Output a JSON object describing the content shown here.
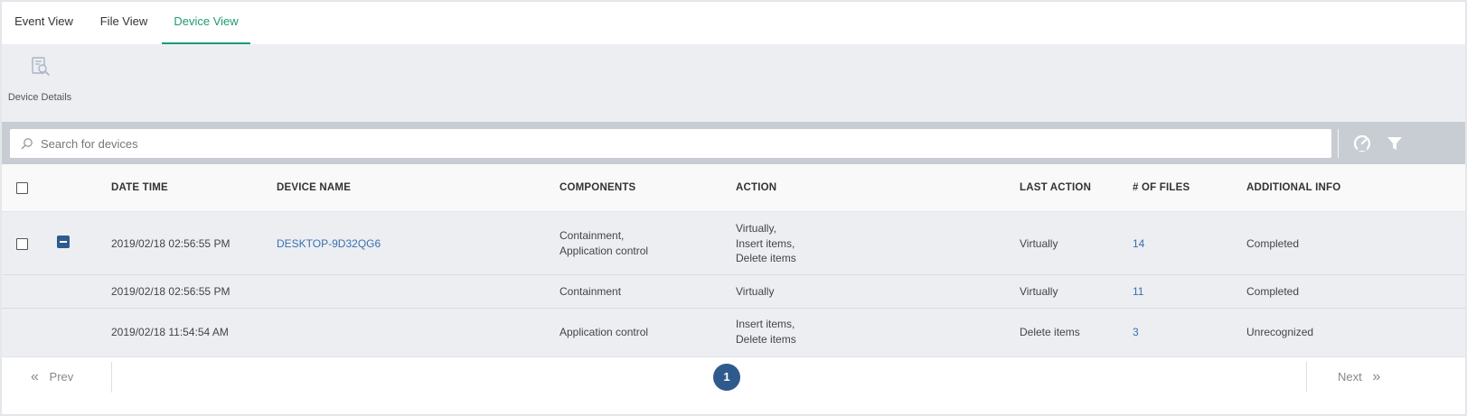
{
  "tabs": [
    {
      "label": "Event View",
      "active": false
    },
    {
      "label": "File View",
      "active": false
    },
    {
      "label": "Device View",
      "active": true
    }
  ],
  "toolbar": {
    "device_details_label": "Device Details",
    "device_details_icon": "device-details-icon"
  },
  "search": {
    "placeholder": "Search for devices",
    "value": ""
  },
  "header_icons": [
    "gauge-icon",
    "filter-icon"
  ],
  "table": {
    "columns": [
      "DATE TIME",
      "DEVICE NAME",
      "COMPONENTS",
      "ACTION",
      "LAST ACTION",
      "# OF FILES",
      "ADDITIONAL INFO"
    ],
    "rows": [
      {
        "date_time": "2019/02/18 02:56:55 PM",
        "device_name": "DESKTOP-9D32QG6",
        "components": [
          "Containment,",
          "Application control"
        ],
        "action": [
          "Virtually,",
          "Insert items,",
          "Delete items"
        ],
        "last_action": "Virtually",
        "files": "14",
        "additional_info": "Completed"
      },
      {
        "date_time": "2019/02/18 02:56:55 PM",
        "device_name": "",
        "components": [
          "Containment"
        ],
        "action": [
          "Virtually"
        ],
        "last_action": "Virtually",
        "files": "11",
        "additional_info": "Completed"
      },
      {
        "date_time": "2019/02/18 11:54:54 AM",
        "device_name": "",
        "components": [
          "Application control"
        ],
        "action": [
          "Insert items,",
          "Delete items"
        ],
        "last_action": "Delete items",
        "files": "3",
        "additional_info": "Unrecognized"
      }
    ]
  },
  "pagination": {
    "prev_label": "Prev",
    "next_label": "Next",
    "current_page": "1"
  },
  "colors": {
    "accent": "#1b9b72",
    "link": "#3a6fb0",
    "page_active": "#2f5a8e"
  }
}
